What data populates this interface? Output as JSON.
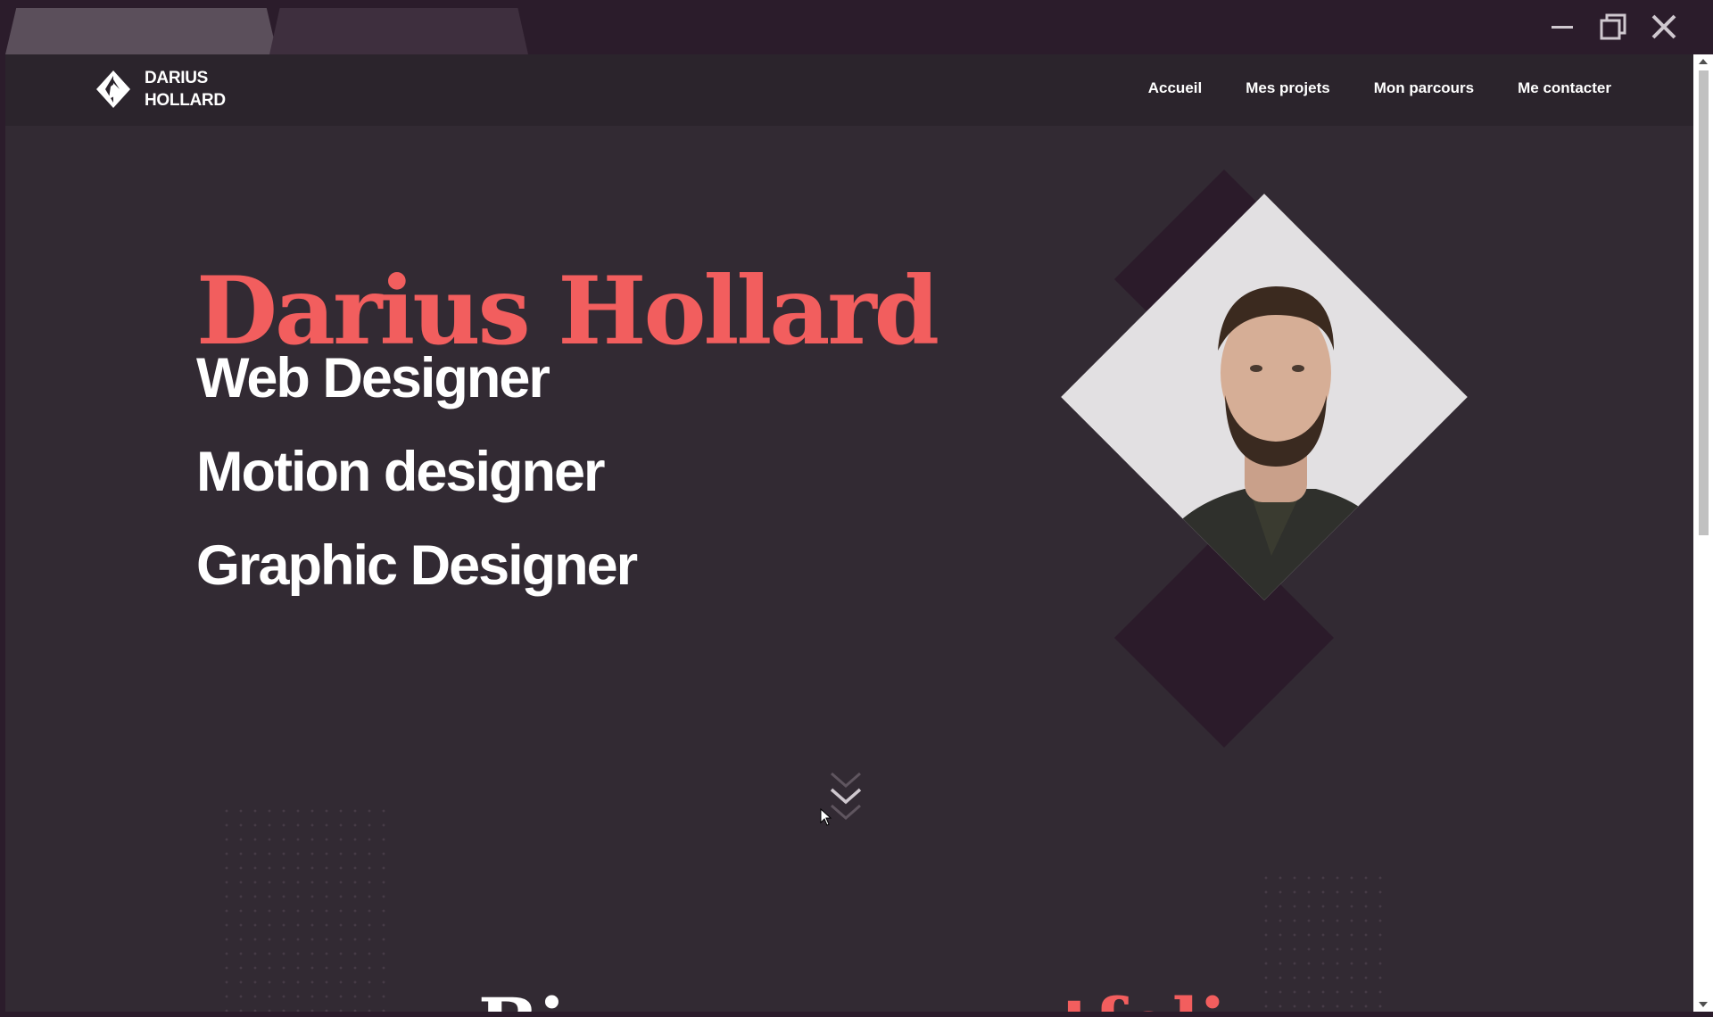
{
  "browser": {
    "tabs": [
      {
        "label": ""
      },
      {
        "label": ""
      }
    ],
    "controls": [
      "minimize-icon",
      "restore-icon",
      "close-icon"
    ]
  },
  "header": {
    "logo_line1": "DARIUS",
    "logo_line2": "HOLLARD",
    "nav": [
      {
        "label": "Accueil"
      },
      {
        "label": "Mes projets"
      },
      {
        "label": "Mon parcours"
      },
      {
        "label": "Me contacter"
      }
    ]
  },
  "hero": {
    "name": "Darius Hollard",
    "roles": [
      "Web Designer",
      "Motion designer",
      "Graphic Designer"
    ]
  },
  "section": {
    "title_part1": "Bi",
    "title_part2": "tfoli"
  },
  "colors": {
    "accent": "#f25e5e",
    "background": "#322a33",
    "navbar": "#2b242c",
    "chrome": "#2b1c2b"
  }
}
